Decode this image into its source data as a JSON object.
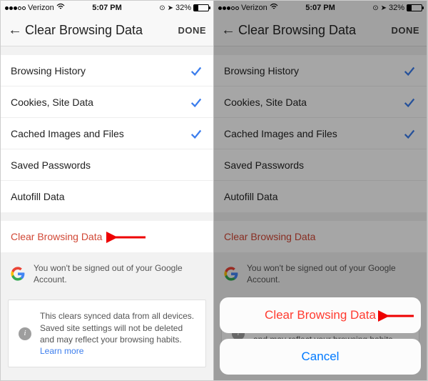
{
  "status": {
    "carrier": "Verizon",
    "time": "5:07 PM",
    "battery_pct": "32%"
  },
  "header": {
    "title": "Clear Browsing Data",
    "done": "DONE"
  },
  "rows": {
    "r0": {
      "label": "Browsing History"
    },
    "r1": {
      "label": "Cookies, Site Data"
    },
    "r2": {
      "label": "Cached Images and Files"
    },
    "r3": {
      "label": "Saved Passwords"
    },
    "r4": {
      "label": "Autofill Data"
    }
  },
  "clear_label": "Clear Browsing Data",
  "note_google": "You won't be signed out of your Google Account.",
  "note_sync": "This clears synced data from all devices. Saved site settings will not be deleted and may reflect your browsing habits. ",
  "learn_more": "Learn more",
  "sheet": {
    "clear": "Clear Browsing Data",
    "cancel": "Cancel"
  }
}
